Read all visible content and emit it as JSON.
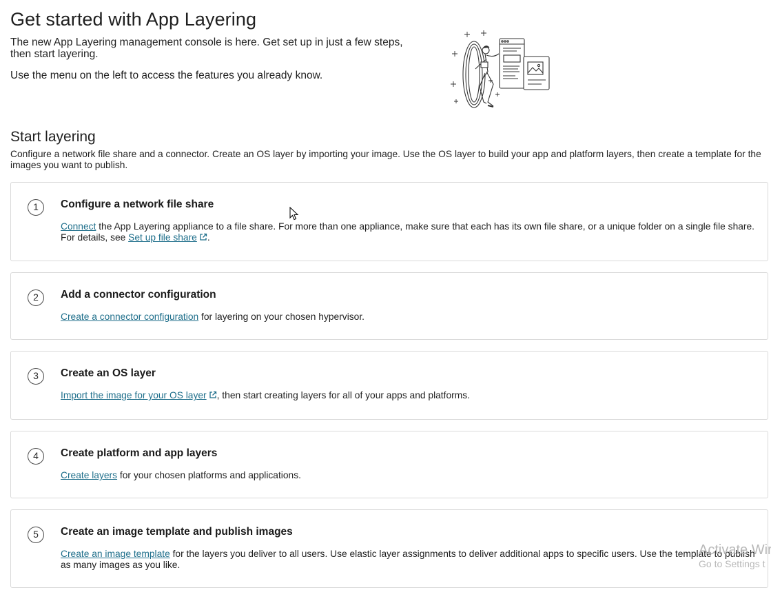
{
  "header": {
    "title": "Get started with App Layering",
    "intro_line1": "The new App Layering management console is here. Get set up in just a few steps, then start layering.",
    "intro_line2": "Use the menu on the left to access the features you already know."
  },
  "layering": {
    "title": "Start layering",
    "description": "Configure a network file share and a connector. Create an OS layer by importing your image. Use the OS layer to build your app and platform layers, then create a template for the images you want to publish."
  },
  "steps": [
    {
      "number": "1",
      "title": "Configure a network file share",
      "link1": "Connect",
      "text1": " the App Layering appliance to a file share. For more than one appliance, make sure that each has its own file share, or a unique folder on a single file share. For details, see ",
      "link2": "Set up file share",
      "text2": "."
    },
    {
      "number": "2",
      "title": "Add a connector configuration",
      "link1": "Create a connector configuration",
      "text1": " for layering on your chosen hypervisor."
    },
    {
      "number": "3",
      "title": "Create an OS layer",
      "link1": "Import the image for your OS layer",
      "text1": ", then start creating layers for all of your apps and platforms."
    },
    {
      "number": "4",
      "title": "Create platform and app layers",
      "link1": "Create layers",
      "text1": " for your chosen platforms and applications."
    },
    {
      "number": "5",
      "title": "Create an image template and publish images",
      "link1": "Create an image template",
      "text1": " for the layers you deliver to all users. Use elastic layer assignments to deliver additional apps to specific users. Use the template to publish as many images as you like."
    }
  ],
  "watermark": {
    "line1": "Activate Wir",
    "line2": "Go to Settings t"
  },
  "icons": {
    "external_link": "external-link-icon",
    "hero": "person-stepping-through-portal-illustration",
    "cursor": "mouse-pointer"
  },
  "colors": {
    "link": "#1f6f8b",
    "border": "#d9d9d9"
  }
}
